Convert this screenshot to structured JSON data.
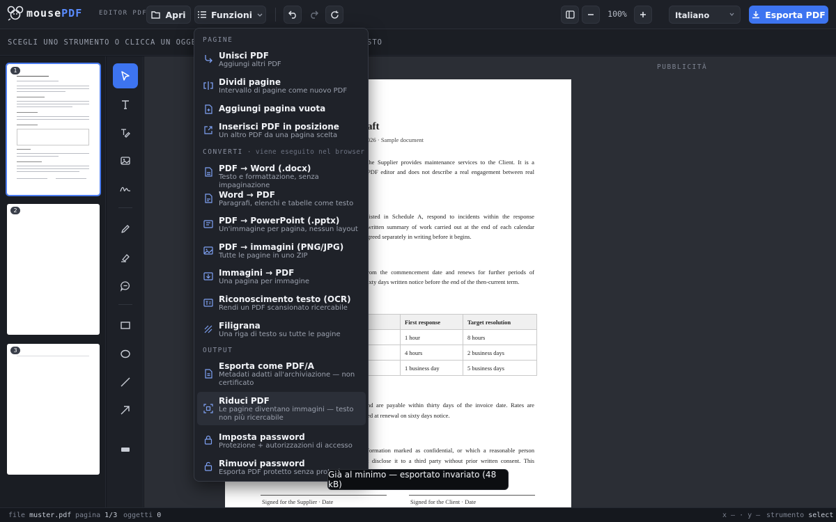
{
  "app": {
    "logo_brand": "mouse",
    "logo_accent": "PDF",
    "tag": "EDITOR PDF"
  },
  "toolbar": {
    "open_label": "Apri",
    "functions_label": "Funzioni",
    "zoom": "100%",
    "language": "Italiano",
    "export_label": "Esporta PDF"
  },
  "hint": {
    "text": "SCEGLI UNO STRUMENTO O CLICCA UN OGGETTO:",
    "text_tail": "STO"
  },
  "thumbnails": [
    {
      "number": "1"
    },
    {
      "number": "2"
    },
    {
      "number": "3"
    }
  ],
  "ad_label": "PUBBLICITÀ",
  "document": {
    "title_fragment": "aft",
    "subtitle_fragment": "026 · Sample document",
    "lines": [
      "the Supplier provides maintenance services to the Client. It is a",
      "PDF editor and does not describe a real engagement between real",
      "listed in Schedule A, respond to incidents within the response",
      "written summary of work carried out at the end of each calendar",
      "greed separately in writing before it begins.",
      "rom the commencement date and renews for further periods of",
      "ixty days written notice before the end of the then-current term.",
      "nd are payable within thirty days of the invoice date. Rates are",
      "ed at renewal on sixty days notice.",
      "formation marked as confidential, or which a reasonable person",
      "t disclose it to a third party without prior written consent. This"
    ],
    "table": {
      "headers": [
        "First response",
        "Target resolution"
      ],
      "rows": [
        [
          "1 hour",
          "8 hours"
        ],
        [
          "4 hours",
          "2 business days"
        ],
        [
          "1 business day",
          "5 business days"
        ]
      ]
    },
    "signature_supplier": "Signed for the Supplier · Date",
    "signature_client": "Signed for the Client · Date"
  },
  "menu": {
    "section_pages": "PAGINE",
    "section_convert": "CONVERTI",
    "section_convert_note": " · viene eseguito nel browser",
    "section_output": "OUTPUT",
    "items": [
      {
        "title": "Unisci PDF",
        "desc": "Aggiungi altri PDF",
        "icon": "merge-icon"
      },
      {
        "title": "Dividi pagine",
        "desc": "Intervallo di pagine come nuovo PDF",
        "icon": "split-icon"
      },
      {
        "title": "Aggiungi pagina vuota",
        "desc": "",
        "icon": "add-page-icon"
      },
      {
        "title": "Inserisci PDF in posizione",
        "desc": "Un altro PDF da una pagina scelta",
        "icon": "insert-icon"
      },
      {
        "title": "PDF → Word (.docx)",
        "desc": "Testo e formattazione, senza impaginazione",
        "icon": "word-file-icon"
      },
      {
        "title": "Word → PDF",
        "desc": "Paragrafi, elenchi e tabelle come testo",
        "icon": "pdf-file-icon"
      },
      {
        "title": "PDF → PowerPoint (.pptx)",
        "desc": "Un'immagine per pagina, nessun layout",
        "icon": "slides-icon"
      },
      {
        "title": "PDF → immagini (PNG/JPG)",
        "desc": "Tutte le pagine in uno ZIP",
        "icon": "image-icon"
      },
      {
        "title": "Immagini → PDF",
        "desc": "Una pagina per immagine",
        "icon": "image-import-icon"
      },
      {
        "title": "Riconoscimento testo (OCR)",
        "desc": "Rendi un PDF scansionato ricercabile",
        "icon": "ocr-icon"
      },
      {
        "title": "Filigrana",
        "desc": "Una riga di testo su tutte le pagine",
        "icon": "watermark-icon"
      },
      {
        "title": "Esporta come PDF/A",
        "desc": "Metadati adatti all'archiviazione — non certificato",
        "icon": "archive-file-icon"
      },
      {
        "title": "Riduci PDF",
        "desc": "Le pagine diventano immagini — testo non più ricercabile",
        "icon": "compress-icon"
      },
      {
        "title": "Imposta password",
        "desc": "Protezione + autorizzazioni di accesso",
        "icon": "lock-icon"
      },
      {
        "title": "Rimuovi password",
        "desc": "Esporta PDF protetto senza protezione",
        "icon": "unlock-icon"
      }
    ]
  },
  "toast": "Già al minimo — esportato invariato (48 kB)",
  "status": {
    "file_label": "file",
    "file_value": "muster.pdf",
    "page_label": "pagina",
    "page_value": "1/3",
    "objects_label": "oggetti",
    "objects_value": "0",
    "coords": "x — · y —",
    "tool_label": "strumento",
    "tool_value": "select"
  },
  "colors": {
    "accent": "#3d74f0",
    "background": "#15181e"
  }
}
